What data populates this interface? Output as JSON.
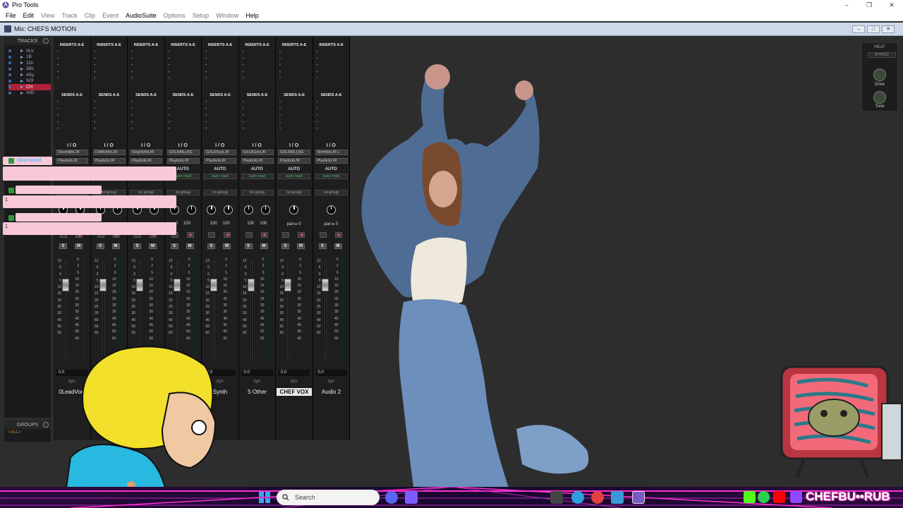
{
  "window": {
    "app_title": "Pro Tools"
  },
  "menu": [
    "File",
    "Edit",
    "View",
    "Track",
    "Clip",
    "Event",
    "AudioSuite",
    "Options",
    "Setup",
    "Window",
    "Help"
  ],
  "mix_window": {
    "title": "Mix: CHEFS MOTION"
  },
  "tracks_panel": {
    "title": "TRACKS",
    "items": [
      "0LV",
      "1B",
      "2Dr",
      "3Bs",
      "4Sy",
      "5Ot",
      "CH",
      "Ad2"
    ]
  },
  "groups_panel": {
    "title": "GROUPS",
    "item": "<ALL>"
  },
  "strip_labels": {
    "inserts": "INSERTS A-E",
    "sends": "SENDS A-E",
    "io": "I / O",
    "auto": "AUTO",
    "auto_read": "auto read",
    "no_group": "no group",
    "solo": "S",
    "mute": "M",
    "dyn": "dyn",
    "volume": "0.0"
  },
  "fader_scale": [
    "12",
    "6",
    "0",
    "5",
    "10",
    "15",
    "20",
    "25",
    "30",
    "40",
    "50",
    "60"
  ],
  "meter_scale": [
    "0",
    "2",
    "5",
    "10",
    "15",
    "20",
    "25",
    "30",
    "35",
    "40",
    "45",
    "50",
    "60"
  ],
  "strips": [
    {
      "input": "StremMxL/R",
      "output": "PlaybckL/R",
      "pan_l": "",
      "pan_r": "",
      "name": "0LeadVocl"
    },
    {
      "input": "ChtMcMxL/R",
      "output": "PlaybckL/R",
      "pan_l": "",
      "pan_r": "",
      "name": ""
    },
    {
      "input": "SmplSrML/R",
      "output": "PlaybckL/R",
      "pan_l": "",
      "pan_r": "",
      "name": ""
    },
    {
      "input": "GXLRML(J)G",
      "output": "PlaybckL/R",
      "pan_l": "0",
      "pan_r": "100",
      "name": ""
    },
    {
      "input": "GXLRSysL/R",
      "output": "PlaybckL/R",
      "pan_l": "100",
      "pan_r": "100",
      "name": "Synth"
    },
    {
      "input": "GXLRGmL/R",
      "output": "PlaybckL/R",
      "pan_l": "100",
      "pan_r": "100",
      "name": "5 Other"
    },
    {
      "input": "GXLRML(J)G",
      "output": "PlaybckL/R",
      "pan_mono": "0",
      "name": "CHEF VOX"
    },
    {
      "input": "StrmMxL/R L",
      "output": "PlaybckL/R",
      "pan_mono": "0",
      "name": "Audio 2"
    }
  ],
  "pan_prefix": "pan",
  "heat_panel": {
    "title": "HEAT",
    "bypass": "BYPASS",
    "drive": "Drive",
    "tone": "Tone"
  },
  "chat": [
    {
      "user": "ShipSquid",
      "message": "",
      "badge_color": "#2e9b3a"
    },
    {
      "user": "",
      "message": "1",
      "badge_color": "#2e9b3a"
    },
    {
      "user": "",
      "message": "1",
      "badge_color": "#2e9b3a"
    }
  ],
  "taskbar": {
    "search_placeholder": "Search",
    "brand": "CHEFBU••RUB"
  },
  "colors": {
    "accent_selected": "#b0213a",
    "chat_bg": "#f8c8d8",
    "neon": "#ff2fd0"
  }
}
